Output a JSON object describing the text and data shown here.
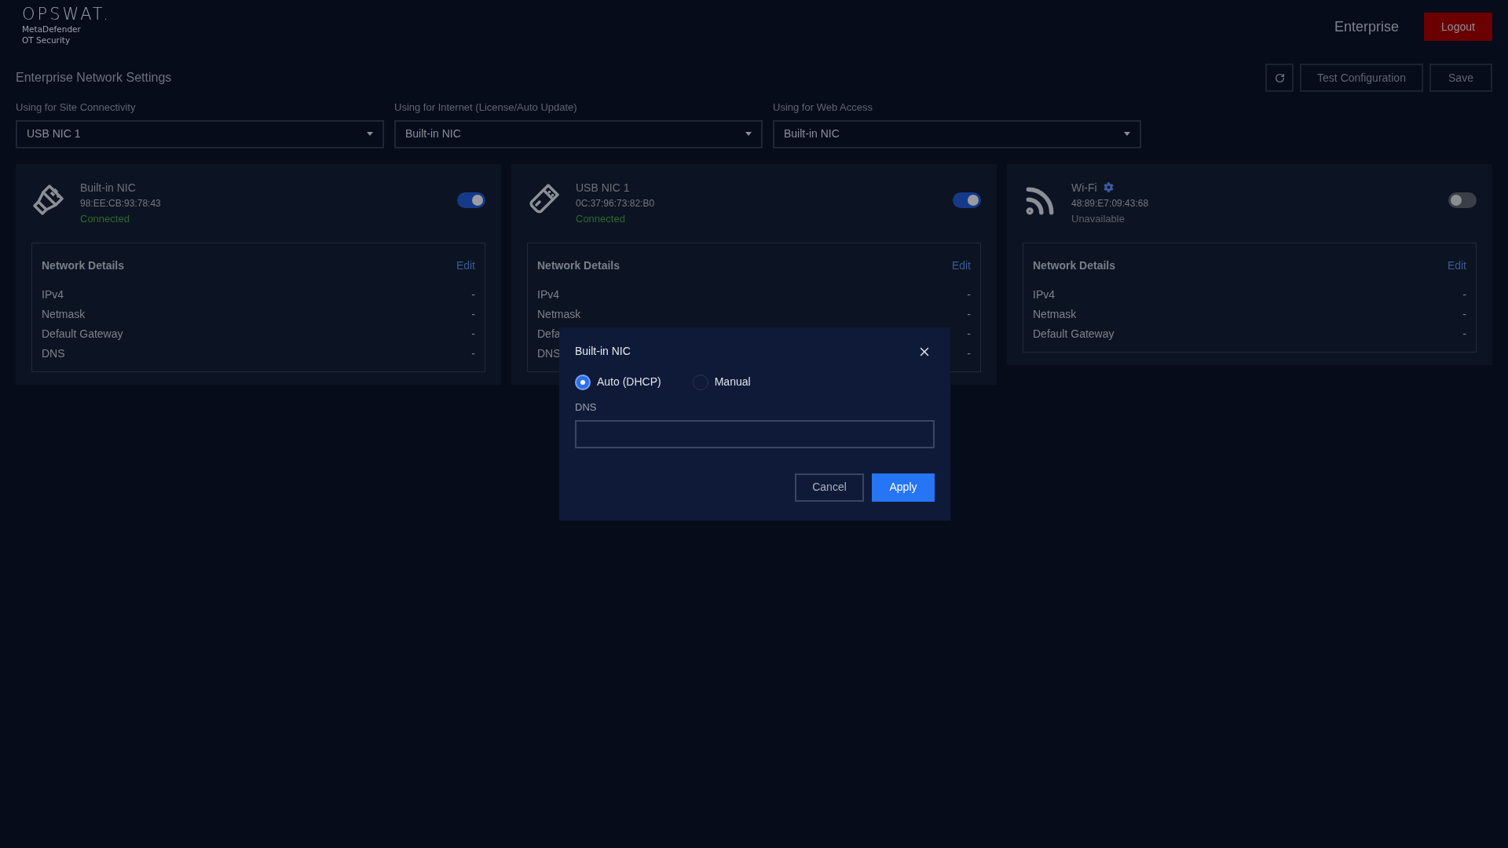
{
  "logo": {
    "brand": "OPSWAT.",
    "product": "MetaDefender",
    "edition": "OT Security"
  },
  "header": {
    "account": "Enterprise",
    "logout": "Logout"
  },
  "page": {
    "title": "Enterprise Network Settings",
    "actions": [
      "Test Configuration",
      "Save"
    ]
  },
  "selects": [
    {
      "label": "Using for Site Connectivity",
      "value": "USB NIC 1"
    },
    {
      "label": "Using for Internet (License/Auto Update)",
      "value": "Built-in NIC"
    },
    {
      "label": "Using for Web Access",
      "value": "Built-in NIC"
    }
  ],
  "adapters": [
    {
      "kind": "ethernet",
      "name": "Built-in NIC",
      "mac": "98:EE:CB:93:78:43",
      "status": "Connected",
      "color": "#2e6b2e",
      "on": true,
      "details_title": "Network Details",
      "edit": "Edit",
      "rows": [
        {
          "label": "IPv4",
          "value": "-"
        },
        {
          "label": "Netmask",
          "value": "-"
        },
        {
          "label": "Default Gateway",
          "value": "-"
        },
        {
          "label": "DNS",
          "value": "-"
        }
      ]
    },
    {
      "kind": "usb",
      "name": "USB NIC 1",
      "mac": "0C:37:96:73:82:B0",
      "status": "Connected",
      "color": "#2e6b2e",
      "on": true,
      "details_title": "Network Details",
      "edit": "Edit",
      "rows": [
        {
          "label": "IPv4",
          "value": "-"
        },
        {
          "label": "Netmask",
          "value": "-"
        },
        {
          "label": "Defa",
          "value": "-"
        },
        {
          "label": "DNS",
          "value": "-"
        }
      ]
    },
    {
      "kind": "wifi",
      "name": "Wi-Fi",
      "mac": "48:89:E7:09:43:68",
      "status": "Unavailable",
      "color": "#5b616b",
      "on": false,
      "details_title": "Network Details",
      "edit": "Edit",
      "rows": [
        {
          "label": "IPv4",
          "value": "-"
        },
        {
          "label": "Netmask",
          "value": "-"
        },
        {
          "label": "Default Gateway",
          "value": "-"
        }
      ]
    }
  ],
  "dialog": {
    "title": "Built-in NIC",
    "modes": [
      {
        "label": "Auto (DHCP)",
        "selected": true
      },
      {
        "label": "Manual",
        "selected": false
      }
    ],
    "dns_label": "DNS",
    "buttons": [
      "Cancel",
      "Apply"
    ]
  }
}
